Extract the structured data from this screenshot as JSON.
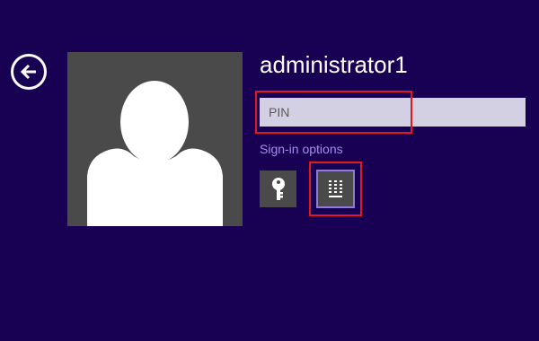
{
  "user": {
    "name": "administrator1"
  },
  "pin_field": {
    "placeholder": "PIN",
    "value": ""
  },
  "sign_in_options": {
    "label": "Sign-in options",
    "options": [
      {
        "name": "password",
        "icon": "key-icon",
        "selected": false
      },
      {
        "name": "pin",
        "icon": "keypad-icon",
        "selected": true
      }
    ]
  },
  "navigation": {
    "back_icon": "back-arrow-icon"
  },
  "colors": {
    "background": "#180052",
    "highlight": "#e3171e",
    "link": "#a88ef0",
    "selected_border": "#8f7ad8",
    "tile": "#4a4a4a",
    "input_bg": "#d4d0e4"
  }
}
